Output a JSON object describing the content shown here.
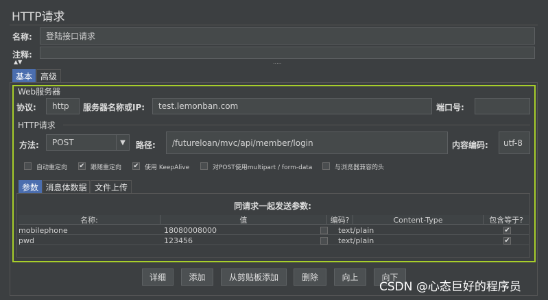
{
  "panel": {
    "title": "HTTP请求"
  },
  "name_row": {
    "label": "名称:",
    "value": "登陆接口请求"
  },
  "comment_row": {
    "label": "注释:",
    "value": ""
  },
  "splitter": {
    "collapse_glyph": "▲▼",
    "grip": "....."
  },
  "main_tabs": [
    {
      "label": "基本",
      "active": true
    },
    {
      "label": "高级",
      "active": false
    }
  ],
  "web_server": {
    "legend": "Web服务器",
    "protocol_label": "协议:",
    "protocol_value": "http",
    "server_label": "服务器名称或IP:",
    "server_value": "test.lemonban.com",
    "port_label": "端口号:",
    "port_value": ""
  },
  "http_request": {
    "legend": "HTTP请求",
    "method_label": "方法:",
    "method_value": "POST",
    "path_label": "路径:",
    "path_value": "/futureloan/mvc/api/member/login",
    "encoding_label": "内容编码:",
    "encoding_value": "utf-8"
  },
  "options": [
    {
      "label": "自动重定向",
      "checked": false
    },
    {
      "label": "跟随重定向",
      "checked": true
    },
    {
      "label": "使用 KeepAlive",
      "checked": true
    },
    {
      "label": "对POST使用multipart / form-data",
      "checked": false
    },
    {
      "label": "与浏览器兼容的头",
      "checked": false
    }
  ],
  "sub_tabs": [
    {
      "label": "参数",
      "active": true
    },
    {
      "label": "消息体数据",
      "active": false
    },
    {
      "label": "文件上传",
      "active": false
    }
  ],
  "params": {
    "header_title": "同请求一起发送参数:",
    "columns": [
      "名称:",
      "值",
      "编码?",
      "Content-Type",
      "包含等于?"
    ],
    "rows": [
      {
        "name": "mobilephone",
        "value": "18080008000",
        "encode": false,
        "content_type": "text/plain",
        "include_equals": true
      },
      {
        "name": "pwd",
        "value": "123456",
        "encode": false,
        "content_type": "text/plain",
        "include_equals": true
      }
    ]
  },
  "buttons": [
    "详细",
    "添加",
    "从剪贴板添加",
    "删除",
    "向上",
    "向下"
  ],
  "watermark": "CSDN @心态巨好的程序员",
  "colors": {
    "highlight_border": "#a8cf2a",
    "active_tab": "#4b6eaf",
    "background": "#3c3f41"
  }
}
